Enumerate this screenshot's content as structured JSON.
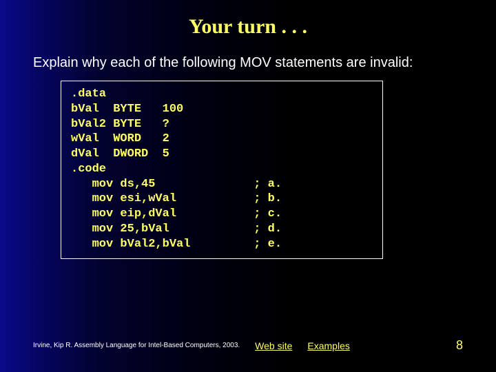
{
  "title": "Your turn . . .",
  "prompt": "Explain why each of the following MOV statements are invalid:",
  "code": ".data\nbVal  BYTE   100\nbVal2 BYTE   ?\nwVal  WORD   2\ndVal  DWORD  5\n.code\n   mov ds,45              ; a.\n   mov esi,wVal           ; b.\n   mov eip,dVal           ; c.\n   mov 25,bVal            ; d.\n   mov bVal2,bVal         ; e.",
  "footer": {
    "credit": "Irvine, Kip R. Assembly Language for Intel-Based Computers, 2003.",
    "link1": "Web site",
    "link2": "Examples",
    "page": "8"
  }
}
